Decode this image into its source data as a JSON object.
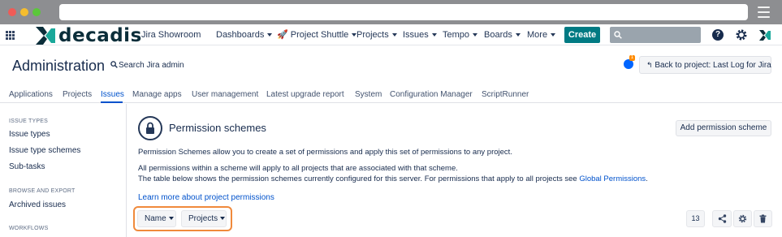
{
  "nav": {
    "site_name": "Jira Showroom",
    "items": [
      {
        "label": "Dashboards"
      },
      {
        "label": "🚀 Project Shuttle"
      },
      {
        "label": "Projects"
      },
      {
        "label": "Issues"
      },
      {
        "label": "Tempo"
      },
      {
        "label": "Boards"
      },
      {
        "label": "More"
      }
    ],
    "create_label": "Create",
    "logo_text": "decadis",
    "help_glyph": "?"
  },
  "admin": {
    "title": "Administration",
    "search_label": "Search Jira admin",
    "notification_count": "1",
    "back_label": "Back to project: Last Log for Jira"
  },
  "tabs": [
    {
      "label": "Applications"
    },
    {
      "label": "Projects"
    },
    {
      "label": "Issues",
      "active": true
    },
    {
      "label": "Manage apps"
    },
    {
      "label": "User management"
    },
    {
      "label": "Latest upgrade report"
    },
    {
      "label": "System"
    },
    {
      "label": "Configuration Manager"
    },
    {
      "label": "ScriptRunner"
    }
  ],
  "sidebar": {
    "sections": [
      {
        "heading": "ISSUE TYPES",
        "links": [
          "Issue types",
          "Issue type schemes",
          "Sub-tasks"
        ]
      },
      {
        "heading": "BROWSE AND EXPORT",
        "links": [
          "Archived issues"
        ]
      },
      {
        "heading": "WORKFLOWS",
        "links": []
      }
    ]
  },
  "main": {
    "title": "Permission schemes",
    "add_button": "Add permission scheme",
    "intro": "Permission Schemes allow you to create a set of permissions and apply this set of permissions to any project.",
    "para1": "All permissions within a scheme will apply to all projects that are associated with that scheme.",
    "para2_prefix": "The table below shows the permission schemes currently configured for this server. For permissions that apply to all projects see ",
    "para2_link": "Global Permissions",
    "para2_suffix": ".",
    "learn_more": "Learn more about project permissions",
    "sort_name": "Name",
    "sort_projects": "Projects",
    "count": "13"
  },
  "colors": {
    "create_button": "#007a83",
    "link": "#0052cc",
    "highlight": "#f08a3c",
    "chrome": "#8d8e91"
  },
  "icons": [
    "apps-grid-icon",
    "decadis-logo-icon",
    "search-icon",
    "help-icon",
    "gear-icon",
    "lock-icon",
    "share-icon",
    "trash-icon",
    "back-arrow-icon",
    "notification-icon"
  ]
}
